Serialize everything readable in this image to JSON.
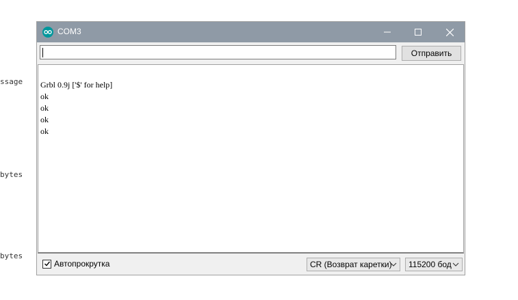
{
  "background_text": {
    "message_fragment": "ssage",
    "bytes_1": "bytes",
    "bytes_2": "bytes"
  },
  "window": {
    "title": "COM3",
    "icon": "arduino-icon",
    "controls": {
      "minimize": "minimize-icon",
      "maximize": "maximize-icon",
      "close": "close-icon"
    }
  },
  "toolbar": {
    "input_value": "",
    "send_label": "Отправить"
  },
  "output": {
    "lines": [
      "Grbl 0.9j ['$' for help]",
      "ok",
      "ok",
      "ok",
      "ok"
    ]
  },
  "statusbar": {
    "autoscroll_label": "Автопрокрутка",
    "autoscroll_checked": true,
    "line_ending": "CR (Возврат каретки)",
    "baud_rate": "115200 бод"
  },
  "colors": {
    "titlebar": "#8f9aa6",
    "arduino_teal": "#00979c"
  }
}
